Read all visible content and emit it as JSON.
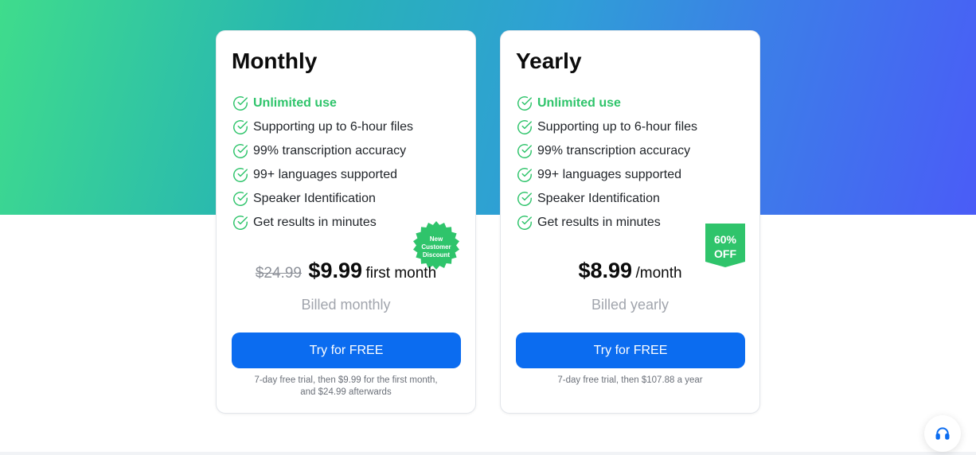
{
  "colors": {
    "gradient_start": "#3fdc8c",
    "gradient_end": "#4a5cf7",
    "accent_green": "#2fc46b",
    "cta_blue": "#0b6cf0",
    "muted_text": "#a1a5ad"
  },
  "plans": [
    {
      "title": "Monthly",
      "features": [
        "Unlimited use",
        "Supporting up to 6-hour files",
        "99% transcription accuracy",
        "99+ languages supported",
        "Speaker Identification",
        "Get results in minutes"
      ],
      "badge": "New Customer Discount",
      "old_price": "$24.99",
      "price": "$9.99",
      "price_suffix": "first month",
      "billed": "Billed monthly",
      "cta_label": "Try for FREE",
      "footnote_line1": "7-day free trial, then $9.99 for the first month,",
      "footnote_line2": "and $24.99 afterwards"
    },
    {
      "title": "Yearly",
      "features": [
        "Unlimited use",
        "Supporting up to 6-hour files",
        "99% transcription accuracy",
        "99+ languages supported",
        "Speaker Identification",
        "Get results in minutes"
      ],
      "badge_line1": "60%",
      "badge_line2": "OFF",
      "price": "$8.99",
      "price_suffix": "/month",
      "billed": "Billed yearly",
      "cta_label": "Try for FREE",
      "footnote": "7-day free trial, then $107.88 a year"
    }
  ],
  "support": {
    "icon": "headset-icon"
  }
}
